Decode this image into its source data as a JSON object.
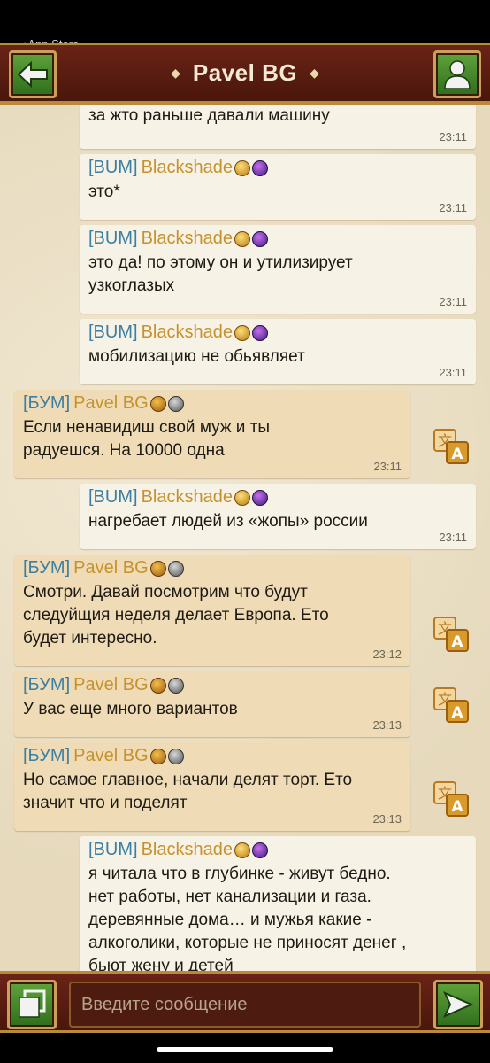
{
  "status_bar": {
    "back_label": "◂ App Store"
  },
  "header": {
    "title": "Pavel BG"
  },
  "messages": [
    {
      "side": "other",
      "tag": "",
      "name": "",
      "text": "за жто раньше давали машину",
      "time": "23:11"
    },
    {
      "side": "other",
      "tag": "[BUM]",
      "name": "Blackshade",
      "text": "это*",
      "time": "23:11"
    },
    {
      "side": "other",
      "tag": "[BUM]",
      "name": "Blackshade",
      "text": "это да! по этому он и утилизирует\nузкоглазых",
      "time": "23:11"
    },
    {
      "side": "other",
      "tag": "[BUM]",
      "name": "Blackshade",
      "text": "мобилизацию не обьявляет",
      "time": "23:11"
    },
    {
      "side": "mine",
      "tag": "[БУМ]",
      "name": "Pavel BG",
      "text": "Если ненавидиш свой муж и ты\nрадуешся. На 10000 одна",
      "time": "23:11"
    },
    {
      "side": "other",
      "tag": "[BUM]",
      "name": "Blackshade",
      "text": "нагребает людей из «жопы» россии",
      "time": "23:11"
    },
    {
      "side": "mine",
      "tag": "[БУМ]",
      "name": "Pavel BG",
      "text": "Смотри. Давай посмотрим что будут\nследуйщия неделя делает Европа. Ето\nбудет интересно.",
      "time": "23:12"
    },
    {
      "side": "mine",
      "tag": "[БУМ]",
      "name": "Pavel BG",
      "text": "У вас еще много вариантов",
      "time": "23:13"
    },
    {
      "side": "mine",
      "tag": "[БУМ]",
      "name": "Pavel BG",
      "text": "Но самое главное, начали делят торт. Ето\nзначит что и поделят",
      "time": "23:13"
    },
    {
      "side": "other",
      "tag": "[BUM]",
      "name": "Blackshade",
      "text": "я читала что в глубинке - живут бедно.\nнет работы, нет канализации и газа.\nдеревянные дома… и мужья какие -\nалкоголики, которые не приносят денег ,\nбьют жену и детей",
      "time": ""
    }
  ],
  "input": {
    "placeholder": "Введите сообщение"
  },
  "icons": {
    "back": "arrow-left-icon",
    "profile": "person-icon",
    "copy": "copy-icon",
    "send": "send-arrow-icon",
    "translate": "translate-icon"
  },
  "colors": {
    "header_bg": "#5a1c10",
    "button_green": "#4a8c2e",
    "gold_border": "#b88a3a",
    "tag_blue": "#3d7fa3",
    "name_gold": "#c6922e",
    "bubble_other": "#f7f2e6",
    "bubble_mine": "#efdcb6"
  }
}
